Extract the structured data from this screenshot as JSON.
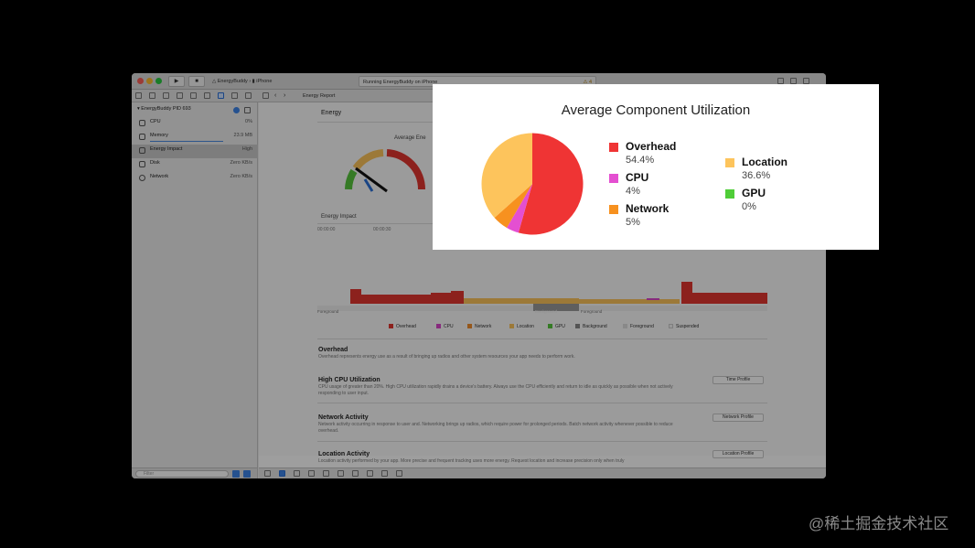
{
  "window": {
    "scheme": "EnergyBuddy",
    "device": "iPhone",
    "activity": "Running EnergyBuddy on iPhone",
    "warning_count": "4",
    "breadcrumb": "Energy Report"
  },
  "navigator": {
    "process": "EnergyBuddy PID 693",
    "items": [
      {
        "label": "CPU",
        "value": "0%",
        "icon": "cpu-icon"
      },
      {
        "label": "Memory",
        "value": "23.9 MB",
        "icon": "memory-icon"
      },
      {
        "label": "Energy Impact",
        "value": "High",
        "icon": "energy-icon",
        "selected": true
      },
      {
        "label": "Disk",
        "value": "Zero KB/s",
        "icon": "disk-icon"
      },
      {
        "label": "Network",
        "value": "Zero KB/s",
        "icon": "network-icon"
      }
    ],
    "filter_placeholder": "Filter"
  },
  "energy": {
    "header": "Energy",
    "gauge_title": "Average Ene",
    "impact_label": "Energy Impact",
    "timeline_ticks": [
      "00:00:00",
      "00:00:30"
    ],
    "state_labels": [
      "Foreground",
      "Background",
      "Foreground"
    ],
    "legend": [
      {
        "label": "Overhead",
        "color": "#e2362f"
      },
      {
        "label": "CPU",
        "color": "#d944c9"
      },
      {
        "label": "Network",
        "color": "#f18d2b"
      },
      {
        "label": "Location",
        "color": "#fbc35b"
      },
      {
        "label": "GPU",
        "color": "#55c43b"
      },
      {
        "label": "Background",
        "color": "#888888"
      },
      {
        "label": "Foreground",
        "color": "#dddddd"
      },
      {
        "label": "Suspended",
        "color": "#f4f4f4"
      }
    ],
    "sections": [
      {
        "title": "Overhead",
        "body": "Overhead represents energy use as a result of bringing up radios and other system resources your app needs to perform work.",
        "button": ""
      },
      {
        "title": "High CPU Utilization",
        "body": "CPU usage of greater than 20%. High CPU utilization rapidly drains a device's battery. Always use the CPU efficiently and return to idle as quickly as possible when not actively responding to user input.",
        "button": "Time Profile"
      },
      {
        "title": "Network Activity",
        "body": "Network activity occurring in response to user and. Networking brings up radios, which require power for prolonged periods. Batch network activity whenever possible to reduce overhead.",
        "button": "Network Profile"
      },
      {
        "title": "Location Activity",
        "body": "Location activity performed by your app. More precise and frequent tracking uses more energy. Request location and increase precision only when truly",
        "button": "Location Profile"
      }
    ]
  },
  "card": {
    "title": "Average Component Utilization",
    "items": [
      {
        "name": "Overhead",
        "pct": "54.4%",
        "color": "#ef3434"
      },
      {
        "name": "CPU",
        "pct": "4%",
        "color": "#e44fd1"
      },
      {
        "name": "Network",
        "pct": "5%",
        "color": "#f7911f"
      },
      {
        "name": "Location",
        "pct": "36.6%",
        "color": "#fdc45c"
      },
      {
        "name": "GPU",
        "pct": "0%",
        "color": "#4fcd38"
      }
    ]
  },
  "chart_data": {
    "type": "pie",
    "title": "Average Component Utilization",
    "categories": [
      "Overhead",
      "CPU",
      "Network",
      "Location",
      "GPU"
    ],
    "values": [
      54.4,
      4,
      5,
      36.6,
      0
    ],
    "colors": [
      "#ef3434",
      "#e44fd1",
      "#f7911f",
      "#fdc45c",
      "#4fcd38"
    ],
    "legend": "right"
  },
  "watermark": "@稀土掘金技术社区"
}
